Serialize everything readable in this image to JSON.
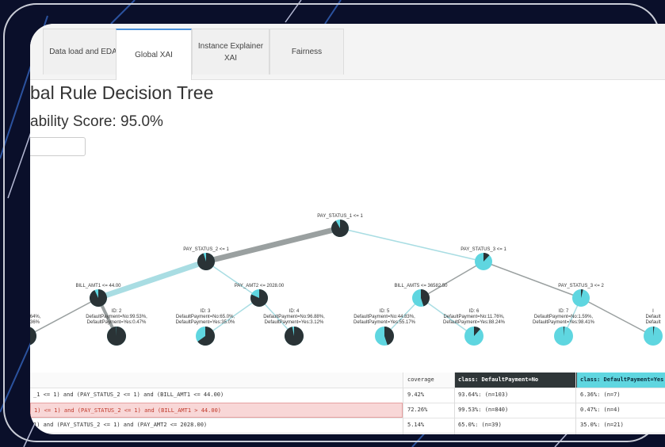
{
  "tabs": [
    {
      "label": "Data load and EDA",
      "active": false
    },
    {
      "label": "Global XAI",
      "active": true
    },
    {
      "label": "Instance Explainer XAI",
      "active": false
    },
    {
      "label": "Fairness",
      "active": false
    }
  ],
  "page": {
    "title": "bal Rule Decision Tree",
    "score": "ability Score: 95.0%"
  },
  "tree": {
    "colors": {
      "dark": "#2a3336",
      "cyan": "#5fd6e0",
      "edge_gray": "#9aa0a0",
      "edge_cyan": "#a9dde3"
    },
    "nodes": [
      {
        "id": "root",
        "label": "PAY_STATUS_1 <= 1",
        "dark_fraction": 0.92
      },
      {
        "id": "n_l",
        "label": "PAY_STATUS_2 <= 1",
        "dark_fraction": 0.95
      },
      {
        "id": "n_r",
        "label": "PAY_STATUS_3 <= 1",
        "dark_fraction": 0.12
      },
      {
        "id": "n_ll",
        "label": "BILL_AMT1 <= 44.00",
        "dark_fraction": 0.93
      },
      {
        "id": "n_lr",
        "label": "PAY_AMT2 <= 2028.00",
        "dark_fraction": 0.82
      },
      {
        "id": "n_rl",
        "label": "BILL_AMT5 <= 36582.50",
        "dark_fraction": 0.45
      },
      {
        "id": "n_rr",
        "label": "PAY_STATUS_3 <= 2",
        "dark_fraction": 0.04
      },
      {
        "id": "leaf1",
        "title": "",
        "line1": "=No:93.64%,",
        "line2": "=Yes:6.36%",
        "dark_fraction": 0.9364
      },
      {
        "id": "leaf2",
        "title": "ID: 2",
        "line1": "DefaultPayment=No:99.53%,",
        "line2": "DefaultPayment=Yes:0.47%",
        "dark_fraction": 0.9953
      },
      {
        "id": "leaf3",
        "title": "ID: 3",
        "line1": "DefaultPayment=No:65.0%,",
        "line2": "DefaultPayment=Yes:35.0%",
        "dark_fraction": 0.65
      },
      {
        "id": "leaf4",
        "title": "ID: 4",
        "line1": "DefaultPayment=No:96.88%,",
        "line2": "DefaultPayment=Yes:3.12%",
        "dark_fraction": 0.9688
      },
      {
        "id": "leaf5",
        "title": "ID: 5",
        "line1": "DefaultPayment=No:44.83%,",
        "line2": "DefaultPayment=Yes:55.17%",
        "dark_fraction": 0.4483
      },
      {
        "id": "leaf6",
        "title": "ID: 6",
        "line1": "DefaultPayment=No:11.76%,",
        "line2": "DefaultPayment=Yes:88.24%",
        "dark_fraction": 0.1176
      },
      {
        "id": "leaf7",
        "title": "ID: 7",
        "line1": "DefaultPayment=No:1.59%,",
        "line2": "DefaultPayment=Yes:98.41%",
        "dark_fraction": 0.0159
      },
      {
        "id": "leaf8",
        "title": "I",
        "line1": "Default",
        "line2": "Default",
        "dark_fraction": 0.02
      }
    ]
  },
  "rules": {
    "headers": [
      "",
      "coverage",
      "class: DefaultPayment=No",
      "class: DefaultPayment=Yes"
    ],
    "rows": [
      {
        "rule": "_1 <= 1) and (PAY_STATUS_2 <= 1) and (BILL_AMT1 <= 44.00)",
        "coverage": "9.42%",
        "no": "93.64%: (n=103)",
        "yes": "6.36%: (n=7)",
        "highlight": false
      },
      {
        "rule": "1) <= 1) and (PAY_STATUS_2 <= 1) and (BILL_AMT1 > 44.00)",
        "coverage": "72.26%",
        "no": "99.53%: (n=840)",
        "yes": "0.47%: (n=4)",
        "highlight": true
      },
      {
        "rule": "1) and (PAY_STATUS_2 <= 1) and (PAY_AMT2 <= 2028.00)",
        "coverage": "5.14%",
        "no": "65.0%: (n=39)",
        "yes": "35.0%: (n=21)",
        "highlight": false
      }
    ]
  }
}
